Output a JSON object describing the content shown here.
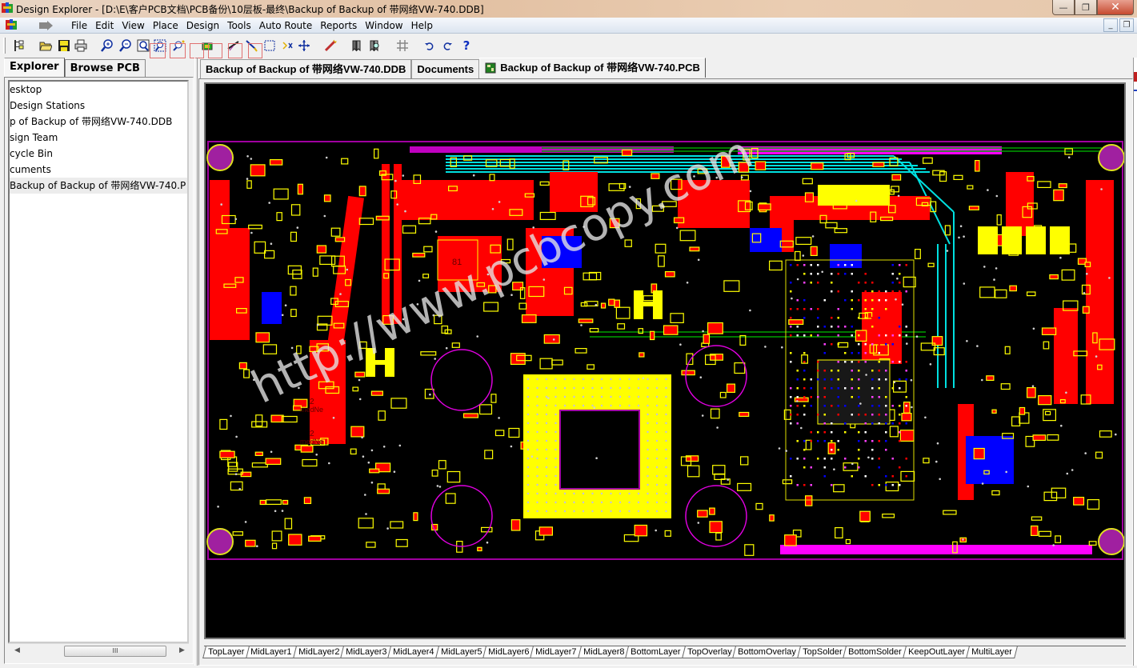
{
  "window": {
    "title": "Design Explorer - [D:\\E\\客户PCB文档\\PCB备份\\10层板-最终\\Backup of Backup of 带网络VW-740.DDB]",
    "minimize": "—",
    "restore": "❐",
    "close": "✕"
  },
  "menubar": {
    "items": [
      "File",
      "Edit",
      "View",
      "Place",
      "Design",
      "Tools",
      "Auto Route",
      "Reports",
      "Window",
      "Help"
    ],
    "mdi_minimize": "_",
    "mdi_restore": "❐"
  },
  "toolbar": {
    "icons": [
      "tree-toggle-icon",
      "open-folder-icon",
      "save-icon",
      "print-icon",
      "zoom-in-icon",
      "zoom-out-icon",
      "zoom-fit-icon",
      "zoom-area-icon",
      "zoom-around-point-icon",
      "component-icon",
      "route-icon",
      "wire-icon",
      "select-area-icon",
      "deselect-icon",
      "move-icon",
      "magic-wand-icon",
      "library-icon",
      "browse-library-icon",
      "grid-icon",
      "undo-icon",
      "redo-icon",
      "help-icon"
    ]
  },
  "explorer": {
    "tabs": [
      "Explorer",
      "Browse PCB"
    ],
    "active_tab": "Explorer",
    "tree": [
      {
        "label": "esktop",
        "selected": false
      },
      {
        "label": " Design Stations",
        "selected": false
      },
      {
        "label": "p of Backup of 带网络VW-740.DDB",
        "selected": false
      },
      {
        "label": "sign Team",
        "selected": false
      },
      {
        "label": "cycle Bin",
        "selected": false
      },
      {
        "label": "cuments",
        "selected": false
      },
      {
        "label": " Backup of Backup of 带网络VW-740.P",
        "selected": true
      }
    ],
    "scroll_thumb": "III"
  },
  "documents": {
    "tabs": [
      {
        "label": "Backup of Backup of 带网络VW-740.DDB",
        "active": false
      },
      {
        "label": "Documents",
        "active": false
      },
      {
        "label": "Backup of Backup of 带网络VW-740.PCB",
        "active": true
      }
    ]
  },
  "pcb": {
    "watermark": "http://www.pcbcopy.com",
    "chip_labels": [
      "81",
      "2",
      "medNe",
      "2",
      "medNe"
    ],
    "colors": {
      "background": "#000000",
      "top_layer": "#ff0000",
      "bottom_layer": "#0000ff",
      "top_overlay": "#ffff00",
      "multi_layer": "#c0c0c0",
      "keepout": "#ff00ff",
      "mid_cyan": "#00ffff",
      "mid_green": "#00a000",
      "board_outline": "#ff00ff",
      "pad_purple": "#a020a0"
    }
  },
  "layers": {
    "tabs": [
      "TopLayer",
      "MidLayer1",
      "MidLayer2",
      "MidLayer3",
      "MidLayer4",
      "MidLayer5",
      "MidLayer6",
      "MidLayer7",
      "MidLayer8",
      "BottomLayer",
      "TopOverlay",
      "BottomOverlay",
      "TopSolder",
      "BottomSolder",
      "KeepOutLayer",
      "MultiLayer"
    ],
    "active": "TopLayer"
  }
}
